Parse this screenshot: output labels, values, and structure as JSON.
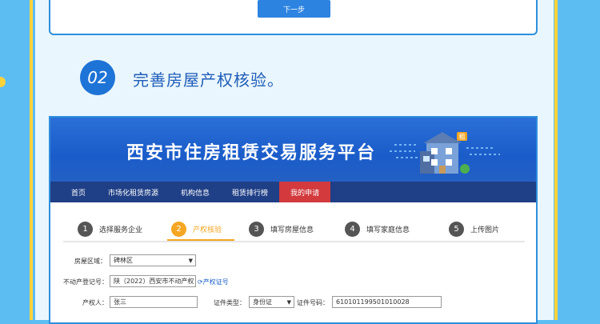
{
  "top_card": {
    "next_label": "下一步"
  },
  "section": {
    "number": "02",
    "title": "完善房屋产权核验。"
  },
  "banner": {
    "title": "西安市住房租赁交易服务平台"
  },
  "nav": {
    "items": [
      {
        "label": "首页"
      },
      {
        "label": "市场化租赁房源"
      },
      {
        "label": "机构信息"
      },
      {
        "label": "租赁排行榜"
      },
      {
        "label": "我的申请"
      }
    ],
    "active_index": 4
  },
  "steps": [
    {
      "num": "1",
      "label": "选择服务企业"
    },
    {
      "num": "2",
      "label": "产权核验"
    },
    {
      "num": "3",
      "label": "填写房屋信息"
    },
    {
      "num": "4",
      "label": "填写家庭信息"
    },
    {
      "num": "5",
      "label": "上传图片"
    }
  ],
  "form": {
    "district_label": "房屋区域：",
    "district_value": "碑林区",
    "cert_no_label": "不动产登记号：",
    "cert_no_value": "陕（2022）西安市不动产权",
    "reload_label": "产权证号",
    "owner_label": "产权人：",
    "owner_value": "张三",
    "id_type_label": "证件类型：",
    "id_type_value": "身份证",
    "id_no_label": "证件号码：",
    "id_no_value": "610101199501010028"
  },
  "colors": {
    "accent": "#1e73d6",
    "nav_bg": "#1f3f86",
    "nav_active": "#d23a3e",
    "step_active": "#f5a623",
    "highlight": "#ffd23a"
  }
}
